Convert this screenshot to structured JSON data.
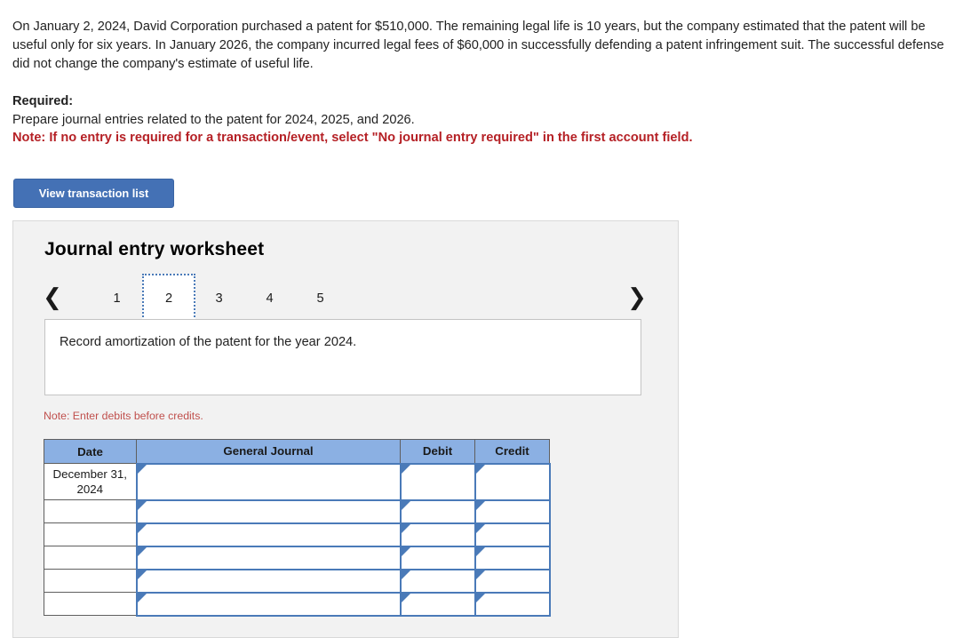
{
  "problem": {
    "statement": "On January 2, 2024, David Corporation purchased a patent for $510,000. The remaining legal life is 10 years, but the company estimated that the patent will be useful only for six years. In January 2026, the company incurred legal fees of $60,000 in successfully defending a patent infringement suit. The successful defense did not change the company's estimate of useful life."
  },
  "required": {
    "label": "Required:",
    "instruction": "Prepare journal entries related to the patent for 2024, 2025, and 2026.",
    "note": "Note: If no entry is required for a transaction/event, select \"No journal entry required\" in the first account field."
  },
  "toolbar": {
    "view_transaction_list_label": "View transaction list"
  },
  "worksheet": {
    "title": "Journal entry worksheet",
    "prev_arrow": "‹",
    "next_arrow": "›",
    "tabs": [
      {
        "label": "1",
        "active": false
      },
      {
        "label": "2",
        "active": true
      },
      {
        "label": "3",
        "active": false
      },
      {
        "label": "4",
        "active": false
      },
      {
        "label": "5",
        "active": false
      }
    ],
    "description": "Record amortization of the patent for the year 2024.",
    "debits_note": "Note: Enter debits before credits.",
    "table": {
      "columns": [
        "Date",
        "General Journal",
        "Debit",
        "Credit"
      ],
      "rows": [
        {
          "date": "December 31, 2024",
          "general_journal": "",
          "debit": "",
          "credit": ""
        },
        {
          "date": "",
          "general_journal": "",
          "debit": "",
          "credit": ""
        },
        {
          "date": "",
          "general_journal": "",
          "debit": "",
          "credit": ""
        },
        {
          "date": "",
          "general_journal": "",
          "debit": "",
          "credit": ""
        },
        {
          "date": "",
          "general_journal": "",
          "debit": "",
          "credit": ""
        },
        {
          "date": "",
          "general_journal": "",
          "debit": "",
          "credit": ""
        }
      ]
    }
  },
  "colors": {
    "button_blue": "#4471b5",
    "table_header_blue": "#8bb0e3",
    "input_border_blue": "#4a7ab8",
    "note_red": "#b52025",
    "debits_note_red": "#c0504d",
    "panel_gray": "#f2f2f2"
  }
}
